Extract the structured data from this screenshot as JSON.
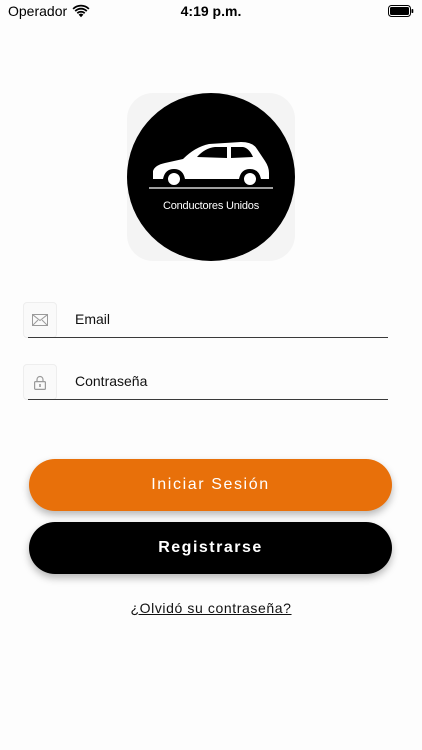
{
  "status_bar": {
    "carrier": "Operador",
    "time": "4:19 p.m."
  },
  "logo": {
    "text": "Conductores Unidos"
  },
  "form": {
    "email_placeholder": "Email",
    "password_placeholder": "Contraseña"
  },
  "actions": {
    "login_label": "Iniciar Sesión",
    "register_label": "Registrarse",
    "forgot_label": "¿Olvidó su contraseña?"
  },
  "colors": {
    "primary": "#e8700a",
    "secondary": "#000000"
  },
  "icons": {
    "email": "envelope-icon",
    "password": "lock-icon",
    "wifi": "wifi-icon",
    "battery": "battery-icon"
  }
}
